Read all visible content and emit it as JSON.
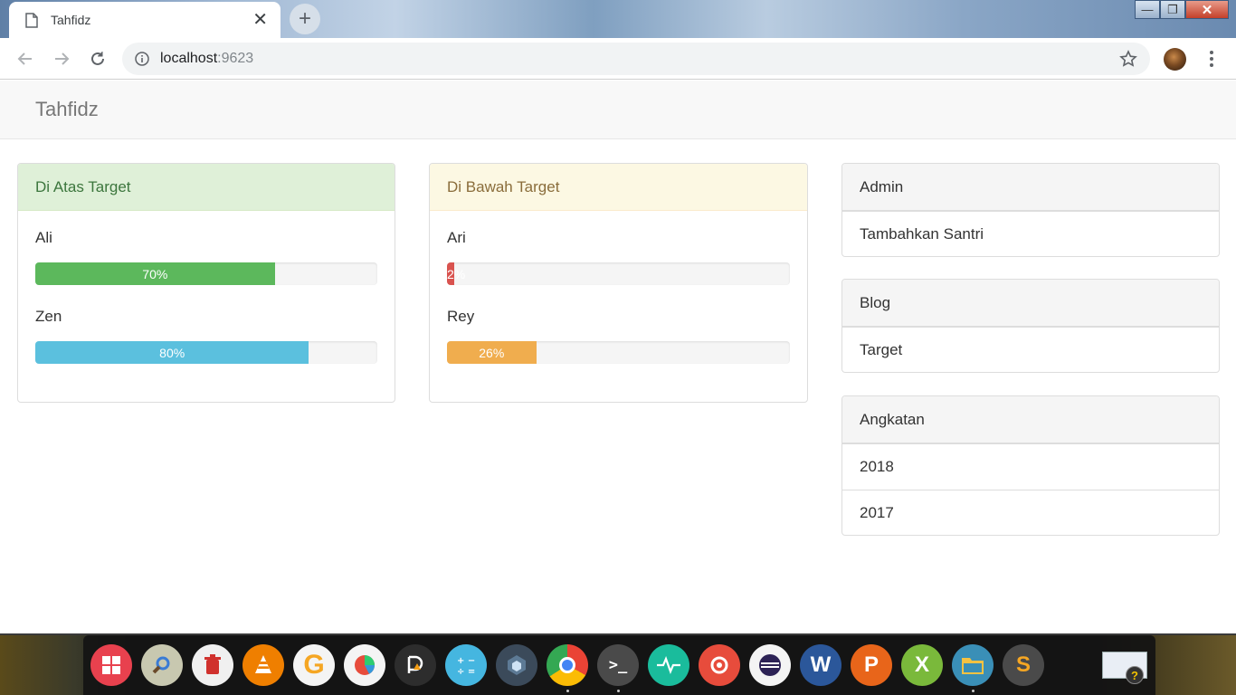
{
  "browser": {
    "tab_title": "Tahfidz",
    "tab_close": "✕",
    "new_tab": "+",
    "url_host": "localhost",
    "url_port": ":9623",
    "window_controls": {
      "minimize": "—",
      "maximize": "❐",
      "close": "✕"
    }
  },
  "navbar": {
    "brand": "Tahfidz"
  },
  "above_target": {
    "title": "Di Atas Target",
    "people": [
      {
        "name": "Ali",
        "progress_percent": 70,
        "label": "70%",
        "color": "#5cb85c"
      },
      {
        "name": "Zen",
        "progress_percent": 80,
        "label": "80%",
        "color": "#5bc0de"
      }
    ]
  },
  "below_target": {
    "title": "Di Bawah Target",
    "people": [
      {
        "name": "Ari",
        "progress_percent": 2,
        "label": "2%",
        "color": "#d9534f"
      },
      {
        "name": "Rey",
        "progress_percent": 26,
        "label": "26%",
        "color": "#f0ad4e"
      }
    ]
  },
  "sidebar": {
    "admin": {
      "title": "Admin",
      "items": [
        "Tambahkan Santri"
      ]
    },
    "blog": {
      "title": "Blog",
      "items": [
        "Target"
      ]
    },
    "angkatan": {
      "title": "Angkatan",
      "items": [
        "2018",
        "2017"
      ]
    }
  },
  "taskbar": {
    "apps": [
      {
        "name": "windows-start",
        "glyph": "",
        "bg": "#e8414e"
      },
      {
        "name": "search",
        "glyph": "",
        "bg": "#c8c8b0"
      },
      {
        "name": "trash",
        "glyph": "",
        "bg": "#f0f0f0"
      },
      {
        "name": "vlc",
        "glyph": "",
        "bg": "#ef7f00"
      },
      {
        "name": "app-g",
        "glyph": "G",
        "bg": "#f4f4f4"
      },
      {
        "name": "pie-app",
        "glyph": "",
        "bg": "#f4f4f4"
      },
      {
        "name": "draw-app",
        "glyph": "",
        "bg": "#2d2d2d"
      },
      {
        "name": "calculator",
        "glyph": "",
        "bg": "#45b6e0"
      },
      {
        "name": "app-stack",
        "glyph": "",
        "bg": "#3b4a5a"
      },
      {
        "name": "chrome",
        "glyph": "",
        "bg": "#4285f4"
      },
      {
        "name": "terminal",
        "glyph": ">_",
        "bg": "#4a4a4a"
      },
      {
        "name": "pulse-app",
        "glyph": "",
        "bg": "#1abc9c"
      },
      {
        "name": "settings-app",
        "glyph": "",
        "bg": "#e74c3c"
      },
      {
        "name": "eclipse",
        "glyph": "",
        "bg": "#f4f4f4"
      },
      {
        "name": "word",
        "glyph": "W",
        "bg": "#2b579a"
      },
      {
        "name": "powerpoint",
        "glyph": "P",
        "bg": "#e8651a"
      },
      {
        "name": "excel",
        "glyph": "X",
        "bg": "#7ab93b"
      },
      {
        "name": "files",
        "glyph": "",
        "bg": "#3a8fb7"
      },
      {
        "name": "sublime",
        "glyph": "S",
        "bg": "#4a4a4a"
      }
    ],
    "help_glyph": "?"
  }
}
